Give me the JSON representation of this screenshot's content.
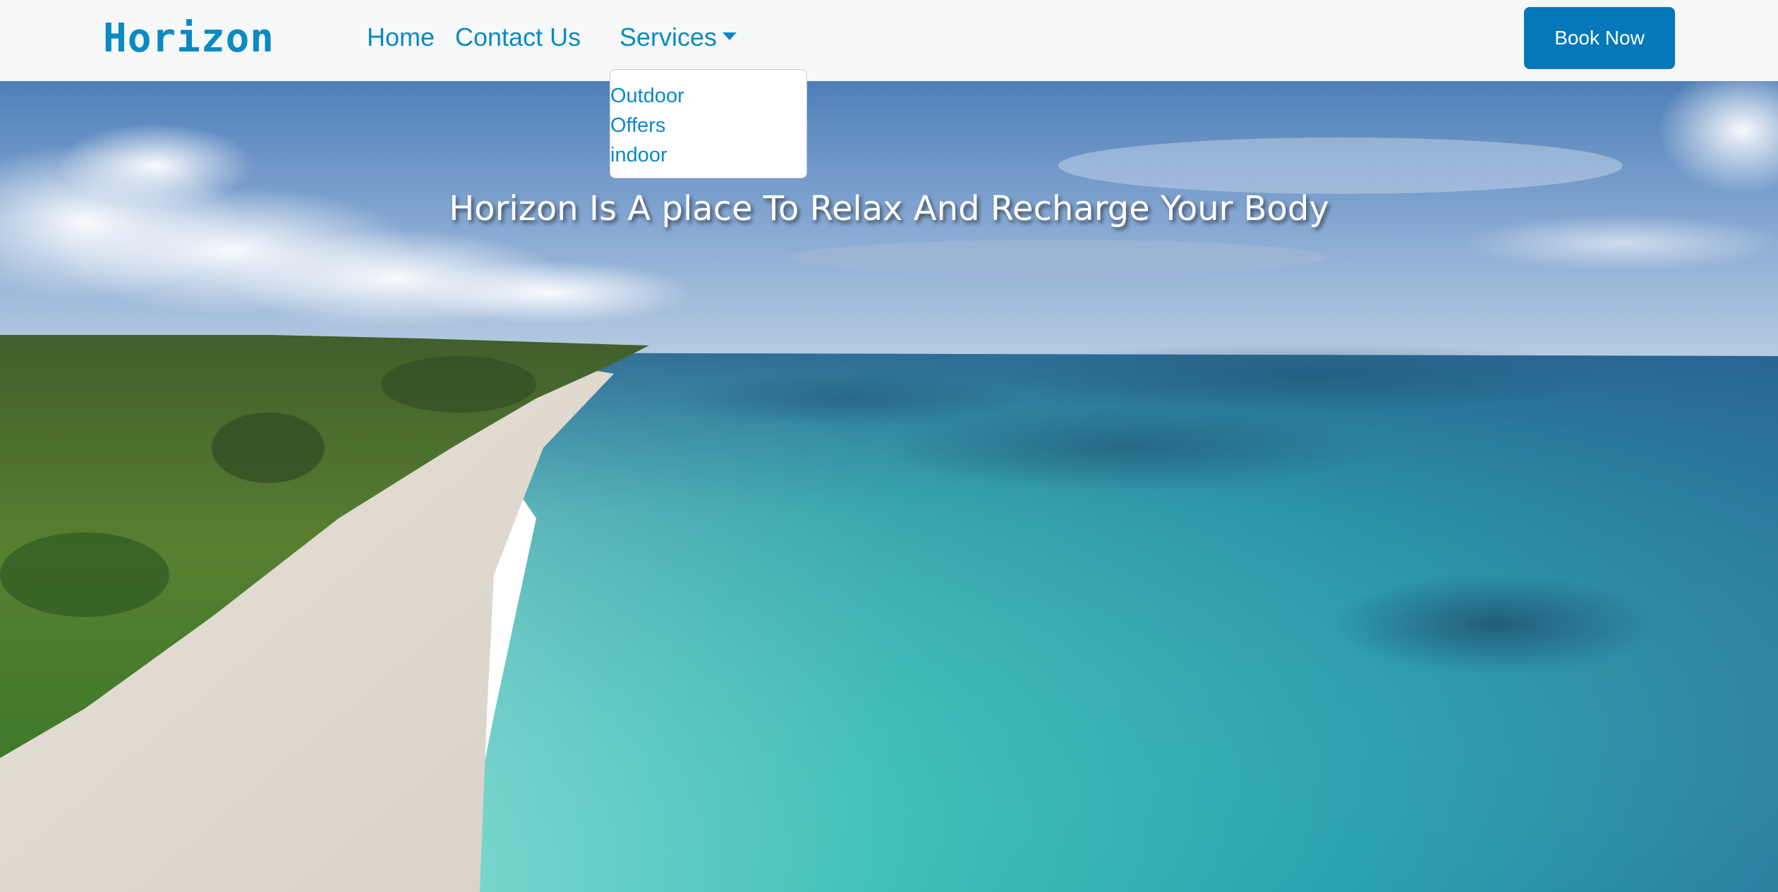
{
  "navbar": {
    "brand": "Horizon",
    "links": [
      {
        "label": "Home"
      },
      {
        "label": "Contact Us"
      },
      {
        "label": "Services"
      }
    ],
    "cta_label": "Book Now"
  },
  "services_dropdown": {
    "items": [
      "Outdoor",
      "Offers",
      "indoor"
    ]
  },
  "hero": {
    "title": "Horizon Is A place To Relax And Recharge Your Body"
  },
  "colors": {
    "brand": "#0a8ac4",
    "button": "#0478b8",
    "navbar_bg": "#f7f8fa"
  }
}
